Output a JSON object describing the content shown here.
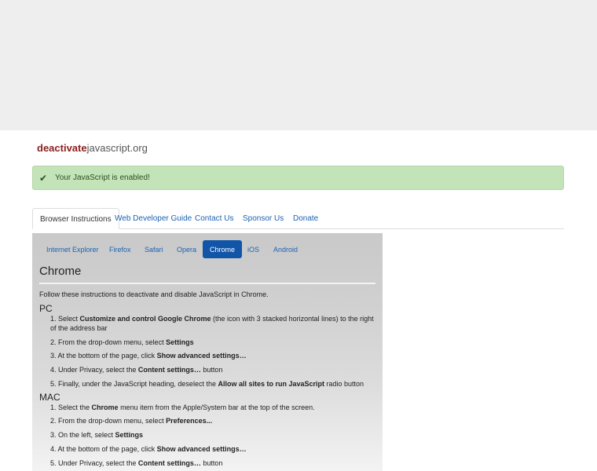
{
  "site": {
    "logo_bold": "deactivate",
    "logo_rest": "javascript.org"
  },
  "alert": {
    "icon": "check-icon",
    "text": "Your JavaScript is enabled!"
  },
  "main_tabs": [
    {
      "label": "Browser Instructions",
      "active": true
    },
    {
      "label": "Web Developer Guide"
    },
    {
      "label": "Contact Us"
    },
    {
      "label": "Sponsor Us"
    },
    {
      "label": "Donate"
    }
  ],
  "browser_tabs": [
    {
      "label": "Internet Explorer"
    },
    {
      "label": "Firefox"
    },
    {
      "label": "Safari"
    },
    {
      "label": "Opera"
    },
    {
      "label": "Chrome",
      "active": true
    },
    {
      "label": "iOS"
    },
    {
      "label": "Android"
    }
  ],
  "content": {
    "title": "Chrome",
    "intro": "Follow these instructions to deactivate and disable JavaScript in Chrome.",
    "pc": {
      "heading": "PC",
      "steps": [
        {
          "a": "1. Select ",
          "b": "Customize and control Google Chrome",
          "c": " (the icon with 3 stacked horizontal lines) to the right of the address bar"
        },
        {
          "a": "2. From the drop-down menu, select ",
          "b": "Settings",
          "c": ""
        },
        {
          "a": "3. At the bottom of the page, click ",
          "b": "Show advanced settings…",
          "c": ""
        },
        {
          "a": "4. Under Privacy, select the ",
          "b": "Content settings…",
          "c": " button"
        },
        {
          "a": "5. Finally, under the JavaScript heading, deselect the ",
          "b": "Allow all sites to run JavaScript",
          "c": " radio button"
        }
      ]
    },
    "mac": {
      "heading": "MAC",
      "steps": [
        {
          "a": "1. Select the ",
          "b": "Chrome",
          "c": " menu item from the Apple/System bar at the top of the screen."
        },
        {
          "a": "2. From the drop-down menu, select ",
          "b": "Preferences...",
          "c": ""
        },
        {
          "a": "3. On the left, select ",
          "b": "Settings",
          "c": ""
        },
        {
          "a": "4. At the bottom of the page, click ",
          "b": "Show advanced settings…",
          "c": ""
        },
        {
          "a": "5. Under Privacy, select the ",
          "b": "Content settings…",
          "c": " button"
        }
      ]
    }
  },
  "colors": {
    "accent": "#1155a8",
    "link": "#1a62b4",
    "alert_bg": "#c3e3b8",
    "logo": "#8b1e1e"
  }
}
